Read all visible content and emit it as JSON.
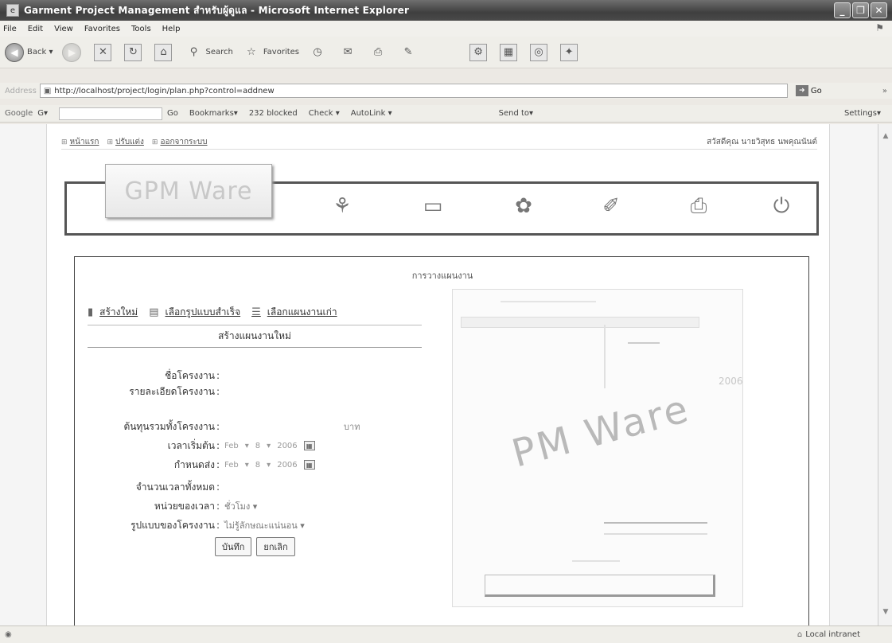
{
  "window": {
    "title": "Garment Project Management สำหรับผู้ดูแล - Microsoft Internet Explorer"
  },
  "menu": [
    "File",
    "Edit",
    "View",
    "Favorites",
    "Tools",
    "Help"
  ],
  "toolbar": {
    "back": "Back",
    "search": "Search",
    "favorites": "Favorites"
  },
  "address": {
    "label": "Address",
    "url": "http://localhost/project/login/plan.php?control=addnew",
    "go": "Go",
    "more": "»"
  },
  "googlebar": {
    "logo": "Google",
    "g": "G▾",
    "go": "Go",
    "bookmarks": "Bookmarks▾",
    "blocked": "232 blocked",
    "check": "Check ▾",
    "autolink": "AutoLink ▾",
    "sendto": "Send to▾",
    "settings": "Settings▾"
  },
  "topnav": {
    "home": "หน้าแรก",
    "profile": "ปรับแต่ง",
    "logout": "ออกจากระบบ",
    "welcome": "สวัสดีคุณ นายวิสุทธ นพคุณนันต์"
  },
  "banner": {
    "logo": "GPM Ware"
  },
  "panel": {
    "title": "การวางแผนงาน",
    "tabs": [
      "สร้างใหม่",
      "เลือกรูปแบบสำเร็จ",
      "เลือกแผนงานเก่า"
    ],
    "subheading": "สร้างแผนงานใหม่"
  },
  "form": {
    "project_name_label": "ชื่อโครงงาน",
    "project_detail_label": "รายละเอียดโครงงาน",
    "total_cost_label": "ต้นทุนรวมทั้งโครงงาน",
    "cost_unit": "บาท",
    "start_label": "เวลาเริ่มต้น",
    "start_month": "Feb",
    "start_day": "8",
    "start_year": "2006",
    "due_label": "กำหนดส่ง",
    "due_month": "Feb",
    "due_day": "8",
    "due_year": "2006",
    "total_time_label": "จำนวนเวลาทั้งหมด",
    "time_unit_label": "หน่วยของเวลา",
    "time_unit_value": "ชั่วโมง",
    "project_type_label": "รูปแบบของโครงงาน",
    "project_type_value": "ไม่รู้ลักษณะแน่นอน",
    "save": "บันทึก",
    "cancel": "ยกเลิก"
  },
  "preview": {
    "logo": "PM Ware",
    "badge": "2006"
  },
  "status": {
    "zone": "Local intranet"
  }
}
